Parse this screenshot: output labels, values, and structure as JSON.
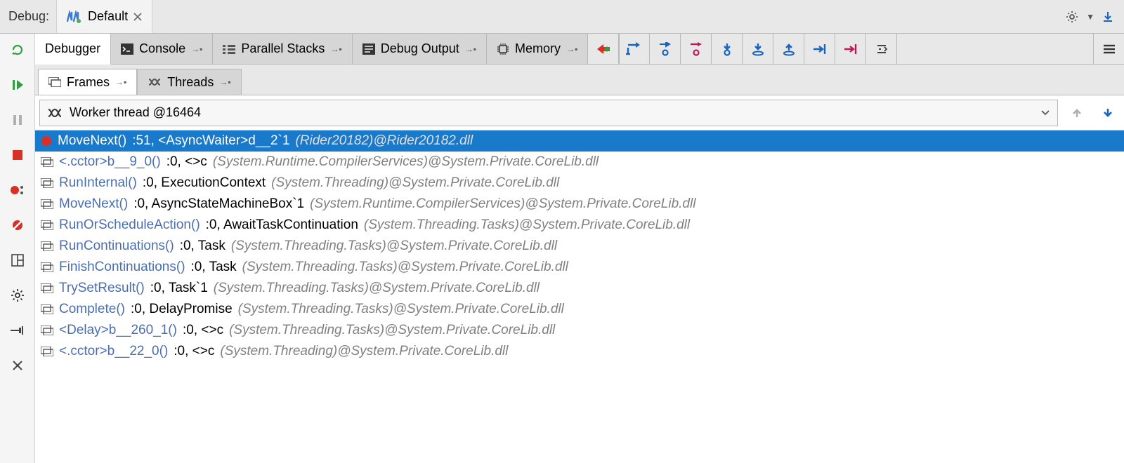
{
  "title": {
    "label": "Debug:",
    "tab": "Default"
  },
  "tabs": {
    "debugger": "Debugger",
    "console": "Console",
    "parallel": "Parallel Stacks",
    "output": "Debug Output",
    "memory": "Memory"
  },
  "subtabs": {
    "frames": "Frames",
    "threads": "Threads"
  },
  "thread_selector": "Worker thread @16464",
  "frames": [
    {
      "method": "MoveNext()",
      "line": ":51, ",
      "cls": "<AsyncWaiter>d__2`1 ",
      "loc": "(Rider20182)@Rider20182.dll",
      "selected": true,
      "bp": true
    },
    {
      "method": "<.cctor>b__9_0()",
      "line": ":0, ",
      "cls": "<>c ",
      "loc": "(System.Runtime.CompilerServices)@System.Private.CoreLib.dll"
    },
    {
      "method": "RunInternal()",
      "line": ":0, ",
      "cls": "ExecutionContext ",
      "loc": "(System.Threading)@System.Private.CoreLib.dll"
    },
    {
      "method": "MoveNext()",
      "line": ":0, ",
      "cls": "AsyncStateMachineBox`1 ",
      "loc": "(System.Runtime.CompilerServices)@System.Private.CoreLib.dll"
    },
    {
      "method": "RunOrScheduleAction()",
      "line": ":0, ",
      "cls": "AwaitTaskContinuation ",
      "loc": "(System.Threading.Tasks)@System.Private.CoreLib.dll"
    },
    {
      "method": "RunContinuations()",
      "line": ":0, ",
      "cls": "Task ",
      "loc": "(System.Threading.Tasks)@System.Private.CoreLib.dll"
    },
    {
      "method": "FinishContinuations()",
      "line": ":0, ",
      "cls": "Task ",
      "loc": "(System.Threading.Tasks)@System.Private.CoreLib.dll"
    },
    {
      "method": "TrySetResult()",
      "line": ":0, ",
      "cls": "Task`1 ",
      "loc": "(System.Threading.Tasks)@System.Private.CoreLib.dll"
    },
    {
      "method": "Complete()",
      "line": ":0, ",
      "cls": "DelayPromise ",
      "loc": "(System.Threading.Tasks)@System.Private.CoreLib.dll"
    },
    {
      "method": "<Delay>b__260_1()",
      "line": ":0, ",
      "cls": "<>c ",
      "loc": "(System.Threading.Tasks)@System.Private.CoreLib.dll"
    },
    {
      "method": "<.cctor>b__22_0()",
      "line": ":0, ",
      "cls": "<>c ",
      "loc": "(System.Threading)@System.Private.CoreLib.dll"
    }
  ]
}
